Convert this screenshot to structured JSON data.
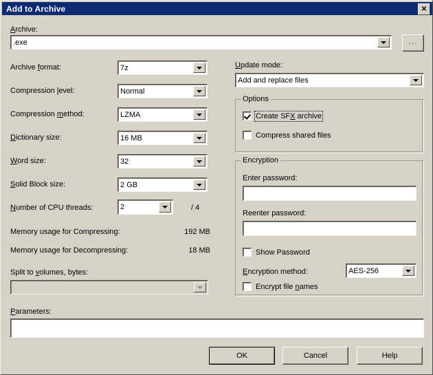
{
  "window": {
    "title": "Add to Archive",
    "close_label": "✕"
  },
  "archive": {
    "label": "Archive:",
    "label_accel": "A",
    "value": ".exe",
    "browse_label": "..."
  },
  "left_settings": [
    {
      "label": "Archive format:",
      "accel": "f",
      "value": "7z"
    },
    {
      "label": "Compression level:",
      "accel": "l",
      "value": "Normal"
    },
    {
      "label": "Compression method:",
      "accel": "m",
      "value": "LZMA"
    },
    {
      "label": "Dictionary size:",
      "accel": "D",
      "value": "16 MB"
    },
    {
      "label": "Word size:",
      "accel": "W",
      "value": "32"
    },
    {
      "label": "Solid Block size:",
      "accel": "S",
      "value": "2 GB"
    }
  ],
  "cpu_threads": {
    "label": "Number of CPU threads:",
    "accel": "N",
    "value": "2",
    "max_text": "/ 4"
  },
  "memory": {
    "compress_label": "Memory usage for Compressing:",
    "compress_value": "192 MB",
    "decompress_label": "Memory usage for Decompressing:",
    "decompress_value": "18 MB"
  },
  "split": {
    "label": "Split to volumes, bytes:",
    "accel": "v",
    "value": ""
  },
  "parameters": {
    "label": "Parameters:",
    "accel": "P",
    "value": ""
  },
  "update_mode": {
    "label": "Update mode:",
    "accel": "U",
    "value": "Add and replace files"
  },
  "options": {
    "title": "Options",
    "items": [
      {
        "label": "Create SFX archive",
        "accel": "X",
        "checked": true,
        "focused": true
      },
      {
        "label": "Compress shared files",
        "accel": "",
        "checked": false,
        "focused": false
      }
    ]
  },
  "encryption": {
    "title": "Encryption",
    "enter_password_label": "Enter password:",
    "enter_password_value": "",
    "reenter_password_label": "Reenter password:",
    "reenter_password_value": "",
    "show_password": {
      "label": "Show Password",
      "checked": false
    },
    "method_label": "Encryption method:",
    "method_accel": "E",
    "method_value": "AES-256",
    "encrypt_names": {
      "label": "Encrypt file names",
      "accel": "n",
      "checked": false
    }
  },
  "buttons": {
    "ok": "OK",
    "cancel": "Cancel",
    "help": "Help"
  }
}
